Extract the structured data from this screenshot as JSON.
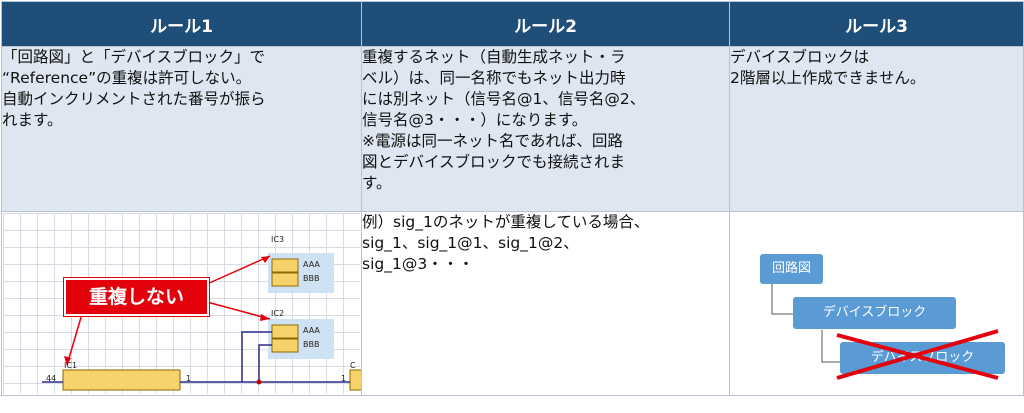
{
  "headers": [
    "ルール1",
    "ルール2",
    "ルール3"
  ],
  "rule1": {
    "text": "「回路図」と「デバイスブロック」で\n“Reference”の重複は許可しない。\n自動インクリメントされた番号が振ら\nれます。"
  },
  "rule2": {
    "text": "重複するネット（自動生成ネット・ラ\nベル）は、同一名称でもネット出力時\nには別ネット（信号名@1、信号名@2、\n信号名@3・・・）になります。\n※電源は同一ネット名であれば、回路\n図とデバイスブロックでも接続されま\nす。",
    "example": "例）sig_1のネットが重複している場合、\nsig_1、sig_1@1、sig_1@2、\nsig_1@3・・・"
  },
  "rule3": {
    "text": "デバイスブロックは\n2階層以上作成できません。"
  },
  "figure1": {
    "callout": "重複しない",
    "labels": {
      "ic3": "IC3",
      "ic2": "IC2",
      "ic1": "IC1",
      "aaa": "AAA",
      "bbb": "BBB",
      "pin44": "44",
      "pin1a": "1",
      "pin1b": "1",
      "cut": "C"
    },
    "colors": {
      "callout": "#e3020b",
      "wire": "#2c2c8c",
      "component": "#f5d26a",
      "block": "#cfe2f3"
    }
  },
  "figure3": {
    "level0": "回路図",
    "level1": "デバイスブロック",
    "level2": "デバイスブロック",
    "colors": {
      "box": "#5b9bd5",
      "cross": "#e3020b"
    }
  }
}
